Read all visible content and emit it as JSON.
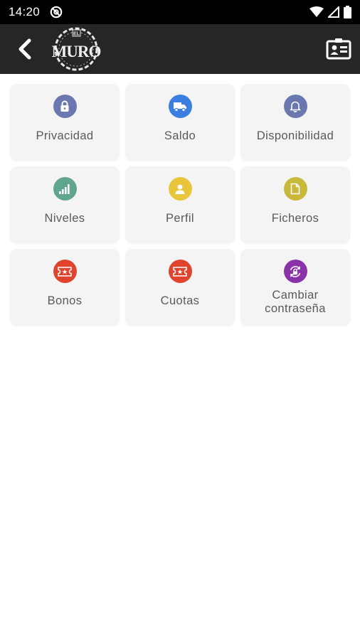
{
  "status_bar": {
    "time": "14:20",
    "icons": [
      "at-sign-icon",
      "wifi-icon",
      "signal-icon",
      "battery-icon"
    ],
    "background": "#000000"
  },
  "app_bar": {
    "background": "#262626",
    "logo_text": "MURO",
    "logo_prefix": "EL",
    "back_icon": "chevron-left-icon",
    "action_icon": "id-card-icon"
  },
  "menu": {
    "items": [
      {
        "label": "Privacidad",
        "icon": "lock-icon",
        "color": "#6b78b0"
      },
      {
        "label": "Saldo",
        "icon": "truck-icon",
        "color": "#3a7fe0"
      },
      {
        "label": "Disponibilidad",
        "icon": "bell-icon",
        "color": "#6b78b0"
      },
      {
        "label": "Niveles",
        "icon": "signal-bars-icon",
        "color": "#5fa58f"
      },
      {
        "label": "Perfil",
        "icon": "user-icon",
        "color": "#e9c53c"
      },
      {
        "label": "Ficheros",
        "icon": "file-icon",
        "color": "#c9b83a"
      },
      {
        "label": "Bonos",
        "icon": "ticket-icon",
        "color": "#e0442f"
      },
      {
        "label": "Cuotas",
        "icon": "ticket-icon",
        "color": "#e0442f"
      },
      {
        "label": "Cambiar contraseña",
        "label_line1": "Cambiar",
        "label_line2": "contraseña",
        "icon": "lock-refresh-icon",
        "color": "#8a33a8"
      }
    ]
  }
}
